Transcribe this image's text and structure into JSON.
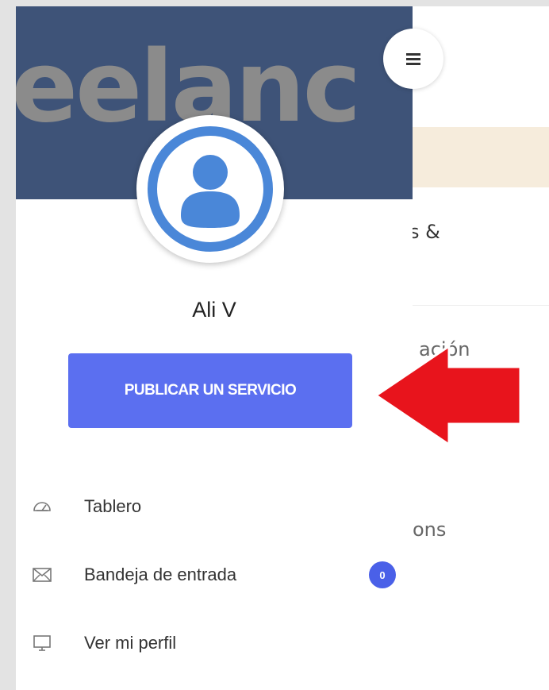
{
  "background_page": {
    "fragments": [
      "s &",
      "ación",
      "ons"
    ]
  },
  "drawer": {
    "header_watermark": "eelanc",
    "user": {
      "name": "Ali V"
    },
    "publish_button_label": "PUBLICAR UN SERVICIO",
    "menu": [
      {
        "label": "Tablero",
        "icon": "dashboard-icon"
      },
      {
        "label": "Bandeja de entrada",
        "icon": "envelope-icon",
        "badge": "0"
      },
      {
        "label": "Ver mi perfil",
        "icon": "monitor-icon"
      }
    ]
  },
  "annotation": {
    "arrow_color": "#e8141c"
  },
  "colors": {
    "header_bg": "#3e5378",
    "button_bg": "#5b6ff0",
    "badge_bg": "#4a60e8",
    "avatar_blue": "#4a87d8"
  }
}
